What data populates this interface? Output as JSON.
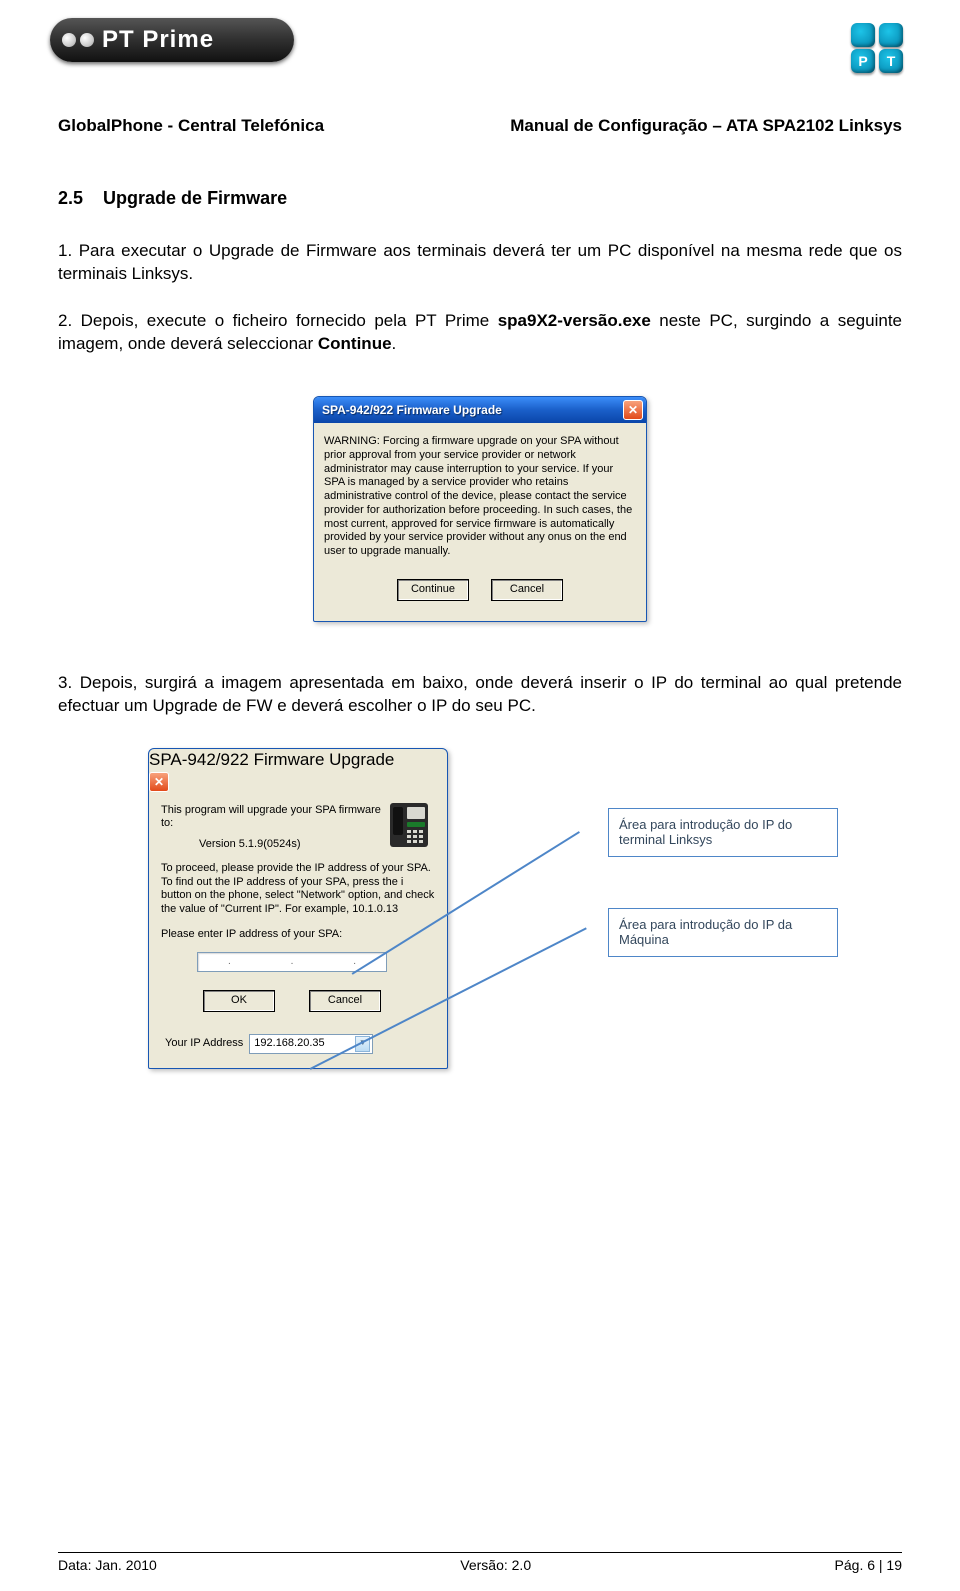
{
  "logo": {
    "brand_text": "PT Prime",
    "badge_p": "P",
    "badge_t": "T"
  },
  "doc": {
    "left_title": "GlobalPhone - Central Telefónica",
    "right_title": "Manual de Configuração – ATA SPA2102 Linksys"
  },
  "section": {
    "number": "2.5",
    "title": "Upgrade de Firmware"
  },
  "paragraphs": {
    "p1_num": "1.",
    "p1": "Para executar o Upgrade de Firmware aos terminais deverá ter um PC disponível na mesma rede que os terminais Linksys.",
    "p2_num": "2.",
    "p2a": "Depois, execute o ficheiro fornecido pela PT Prime ",
    "p2_bold": "spa9X2-versão.exe",
    "p2b": " neste PC, surgindo a seguinte imagem, onde deverá seleccionar ",
    "p2_bold2": "Continue",
    "p2c": ".",
    "p3_num": "3.",
    "p3": "Depois, surgirá a imagem apresentada em baixo, onde deverá inserir o IP do terminal ao qual pretende efectuar um Upgrade de FW e deverá escolher o IP do seu PC."
  },
  "dialog1": {
    "title": "SPA-942/922 Firmware Upgrade",
    "warning": "WARNING: Forcing a firmware upgrade on your SPA without prior approval from your service provider or network administrator may cause interruption to your service. If your SPA is managed by a service provider who retains administrative control of the device, please contact the service provider for authorization before proceeding. In such cases, the most current, approved for service firmware is automatically provided by your service provider without any onus on the end user to upgrade manually.",
    "continue": "Continue",
    "cancel": "Cancel"
  },
  "dialog2": {
    "title": "SPA-942/922 Firmware Upgrade",
    "intro": "This program will upgrade your SPA firmware to:",
    "version": "Version 5.1.9(0524s)",
    "proceed": "To proceed, please provide the IP address of your SPA. To find out the IP address of your SPA, press the i button on the phone, select \"Network\" option, and check the value of \"Current IP\". For example, 10.1.0.13",
    "enter_label": "Please enter IP address of your SPA:",
    "ok": "OK",
    "cancel": "Cancel",
    "your_ip_label": "Your IP Address",
    "your_ip_value": "192.168.20.35"
  },
  "callouts": {
    "c1": "Área para introdução do IP do terminal Linksys",
    "c2": "Área para introdução do IP da Máquina"
  },
  "footer": {
    "date": "Data: Jan. 2010",
    "version": "Versão: 2.0",
    "page": "Pág. 6 | 19"
  }
}
